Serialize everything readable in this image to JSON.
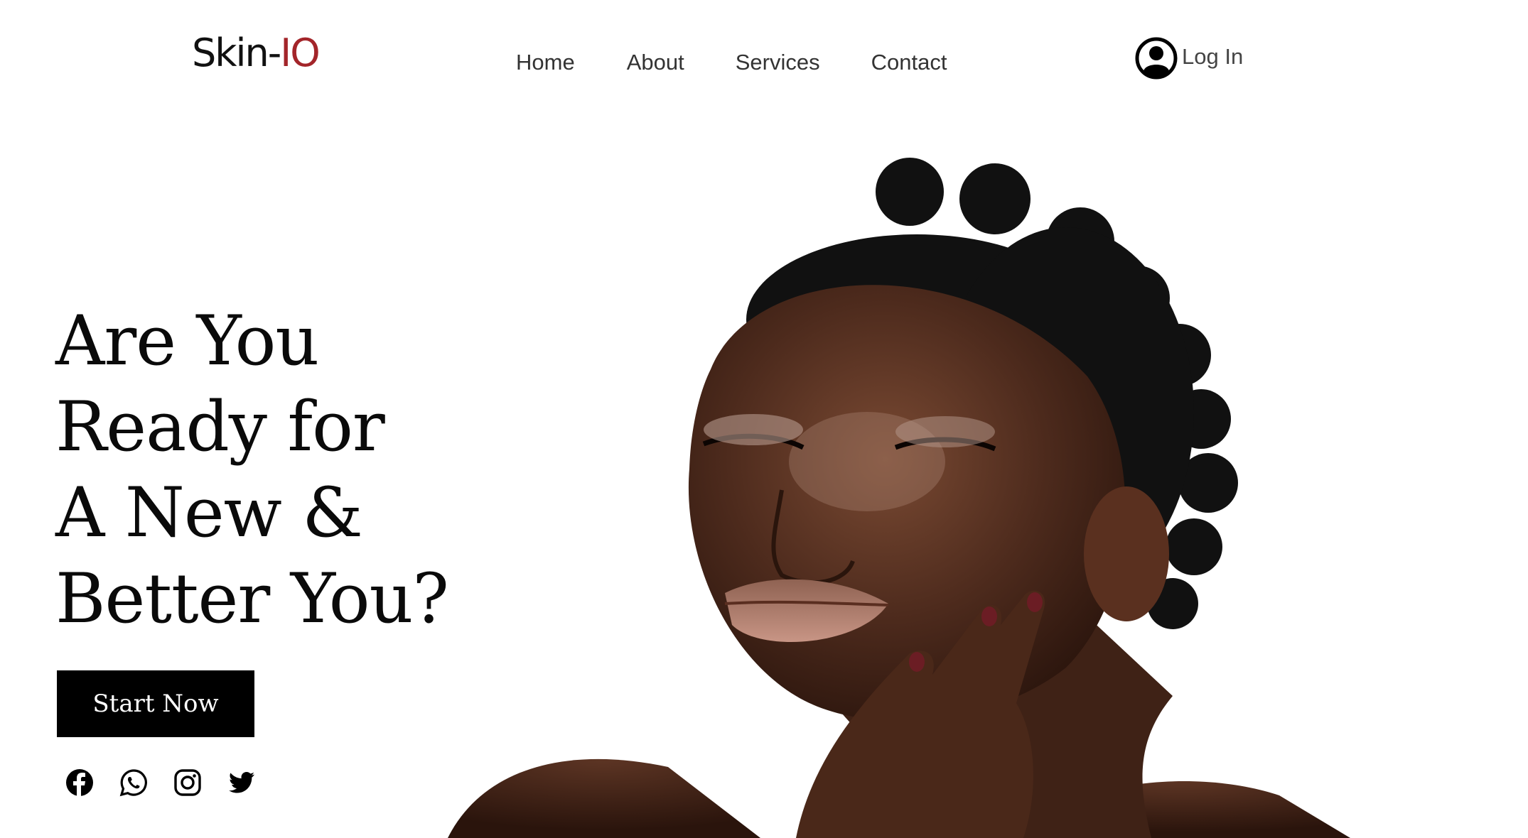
{
  "brand": {
    "name_main": "Skin-",
    "name_accent": "IO",
    "accent_color": "#a3252a"
  },
  "nav": {
    "items": [
      {
        "label": "Home"
      },
      {
        "label": "About"
      },
      {
        "label": "Services"
      },
      {
        "label": "Contact"
      }
    ]
  },
  "login": {
    "label": "Log In",
    "icon": "user-circle-icon"
  },
  "hero": {
    "headline_lines": [
      "Are You",
      "Ready for",
      "A New &",
      "Better You?"
    ],
    "cta_label": "Start Now"
  },
  "socials": [
    {
      "icon": "facebook-icon"
    },
    {
      "icon": "whatsapp-icon"
    },
    {
      "icon": "instagram-icon"
    },
    {
      "icon": "twitter-icon"
    }
  ],
  "colors": {
    "background": "#ffffff",
    "text": "#0a0a0a",
    "cta_bg": "#000000",
    "cta_text": "#ffffff"
  }
}
